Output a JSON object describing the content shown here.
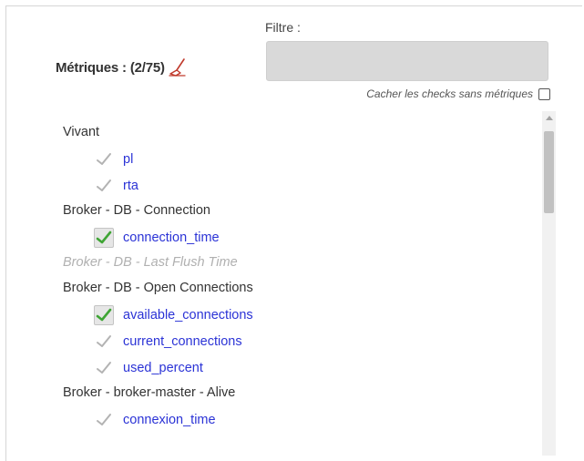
{
  "metrics": {
    "label": "Métriques :",
    "count": "(2/75)",
    "reset_icon": "broom-icon"
  },
  "filter": {
    "label": "Filtre :",
    "value": "",
    "placeholder": ""
  },
  "hide_checks": {
    "label": "Cacher les checks sans métriques",
    "checked": false
  },
  "groups": [
    {
      "name": "Vivant",
      "disabled": false,
      "metrics": [
        {
          "name": "pl",
          "checked": false
        },
        {
          "name": "rta",
          "checked": false
        }
      ]
    },
    {
      "name": "Broker - DB - Connection",
      "disabled": false,
      "metrics": [
        {
          "name": "connection_time",
          "checked": true
        }
      ]
    },
    {
      "name": "Broker - DB - Last Flush Time",
      "disabled": true,
      "metrics": []
    },
    {
      "name": "Broker - DB - Open Connections",
      "disabled": false,
      "metrics": [
        {
          "name": "available_connections",
          "checked": true
        },
        {
          "name": "current_connections",
          "checked": false
        },
        {
          "name": "used_percent",
          "checked": false
        }
      ]
    },
    {
      "name": "Broker - broker-master - Alive",
      "disabled": false,
      "metrics": [
        {
          "name": "connexion_time",
          "checked": false
        }
      ]
    }
  ],
  "colors": {
    "check_checked": "#3fa535",
    "check_unchecked": "#b3b3b3",
    "metric_link": "#2b33d6",
    "broom": "#c0392b"
  }
}
